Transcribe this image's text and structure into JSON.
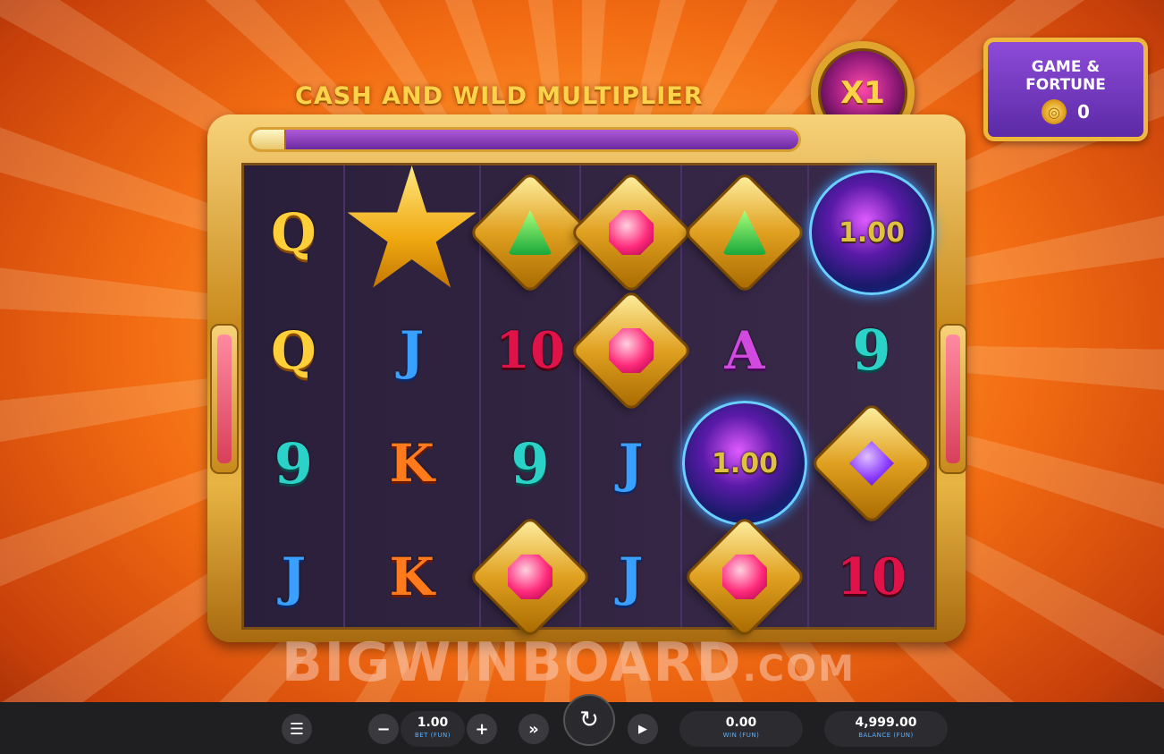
{
  "title": "CASH AND WILD MULTIPLIER",
  "multiplier": "X1",
  "progress": 0.06,
  "fortune": {
    "label_line1": "GAME &",
    "label_line2": "FORTUNE",
    "value": "0"
  },
  "reels": [
    [
      {
        "kind": "letter",
        "symbol": "Q"
      },
      {
        "kind": "letter",
        "symbol": "Q"
      },
      {
        "kind": "letter",
        "symbol": "9"
      },
      {
        "kind": "letter",
        "symbol": "J"
      }
    ],
    [
      {
        "kind": "star",
        "symbol": "star"
      },
      {
        "kind": "letter",
        "symbol": "J"
      },
      {
        "kind": "letter",
        "symbol": "K"
      },
      {
        "kind": "letter",
        "symbol": "K"
      }
    ],
    [
      {
        "kind": "gem",
        "symbol": "green"
      },
      {
        "kind": "letter",
        "symbol": "10"
      },
      {
        "kind": "letter",
        "symbol": "9"
      },
      {
        "kind": "gem",
        "symbol": "pink"
      }
    ],
    [
      {
        "kind": "gem",
        "symbol": "pink"
      },
      {
        "kind": "gem",
        "symbol": "pink"
      },
      {
        "kind": "letter",
        "symbol": "J"
      },
      {
        "kind": "letter",
        "symbol": "J"
      }
    ],
    [
      {
        "kind": "gem",
        "symbol": "green"
      },
      {
        "kind": "letter",
        "symbol": "A"
      },
      {
        "kind": "orb",
        "symbol": "1.00"
      },
      {
        "kind": "gem",
        "symbol": "pink"
      }
    ],
    [
      {
        "kind": "orb",
        "symbol": "1.00"
      },
      {
        "kind": "letter",
        "symbol": "9"
      },
      {
        "kind": "gem",
        "symbol": "purple"
      },
      {
        "kind": "letter",
        "symbol": "10"
      }
    ]
  ],
  "watermark": {
    "main": "BIGWINBOARD",
    "suffix": ".COM"
  },
  "controls": {
    "menu_icon": "menu-icon",
    "minus": "−",
    "plus": "+",
    "bet_value": "1.00",
    "bet_label": "BET (FUN)",
    "win_value": "0.00",
    "win_label": "WIN (FUN)",
    "balance_value": "4,999.00",
    "balance_label": "BALANCE (FUN)",
    "fast_icon": "»",
    "play_icon": "▶",
    "spin_icon": "↻"
  }
}
